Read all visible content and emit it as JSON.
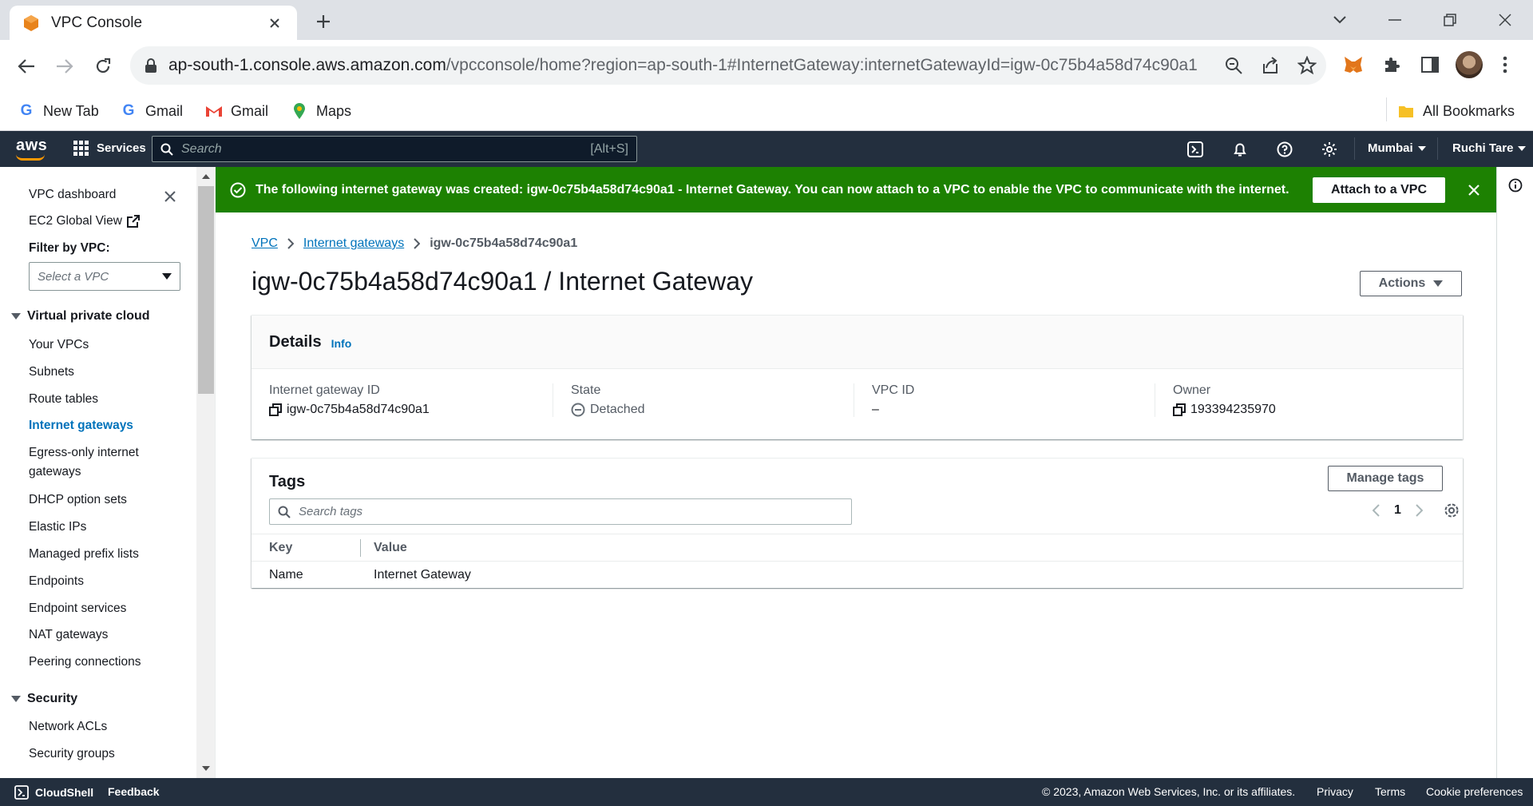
{
  "browser": {
    "tab_title": "VPC Console",
    "url_main": "ap-south-1.console.aws.amazon.com",
    "url_rest": "/vpcconsole/home?region=ap-south-1#InternetGateway:internetGatewayId=igw-0c75b4a58d74c90a1",
    "bookmarks": [
      "New Tab",
      "Gmail",
      "Gmail",
      "Maps"
    ],
    "all_bookmarks": "All Bookmarks"
  },
  "aws_header": {
    "logo": "aws",
    "services": "Services",
    "search_placeholder": "Search",
    "search_shortcut": "[Alt+S]",
    "region": "Mumbai",
    "user": "Ruchi Tare"
  },
  "sidebar": {
    "dashboard": "VPC dashboard",
    "global_view": "EC2 Global View",
    "filter_label": "Filter by VPC:",
    "select_placeholder": "Select a VPC",
    "section_vpc": "Virtual private cloud",
    "items": [
      "Your VPCs",
      "Subnets",
      "Route tables",
      "Internet gateways",
      "Egress-only internet",
      "gateways",
      "DHCP option sets",
      "Elastic IPs",
      "Managed prefix lists",
      "Endpoints",
      "Endpoint services",
      "NAT gateways",
      "Peering connections"
    ],
    "section_security": "Security",
    "security_items": [
      "Network ACLs",
      "Security groups"
    ]
  },
  "flash": {
    "message": "The following internet gateway was created: igw-0c75b4a58d74c90a1 - Internet Gateway. You can now attach to a VPC to enable the VPC to communicate with the internet.",
    "action": "Attach to a VPC"
  },
  "breadcrumb": {
    "vpc": "VPC",
    "igw": "Internet gateways",
    "current": "igw-0c75b4a58d74c90a1"
  },
  "page": {
    "title": "igw-0c75b4a58d74c90a1 / Internet Gateway",
    "actions": "Actions"
  },
  "details": {
    "title": "Details",
    "info": "Info",
    "igw_label": "Internet gateway ID",
    "igw_value": "igw-0c75b4a58d74c90a1",
    "state_label": "State",
    "state_value": "Detached",
    "vpc_label": "VPC ID",
    "vpc_value": "–",
    "owner_label": "Owner",
    "owner_value": "193394235970"
  },
  "tags": {
    "title": "Tags",
    "manage": "Manage tags",
    "search_placeholder": "Search tags",
    "page": "1",
    "col_key": "Key",
    "col_value": "Value",
    "rows": [
      {
        "key": "Name",
        "value": "Internet Gateway"
      }
    ]
  },
  "footer": {
    "cloudshell": "CloudShell",
    "feedback": "Feedback",
    "copyright": "© 2023, Amazon Web Services, Inc. or its affiliates.",
    "privacy": "Privacy",
    "terms": "Terms",
    "cookies": "Cookie preferences"
  }
}
